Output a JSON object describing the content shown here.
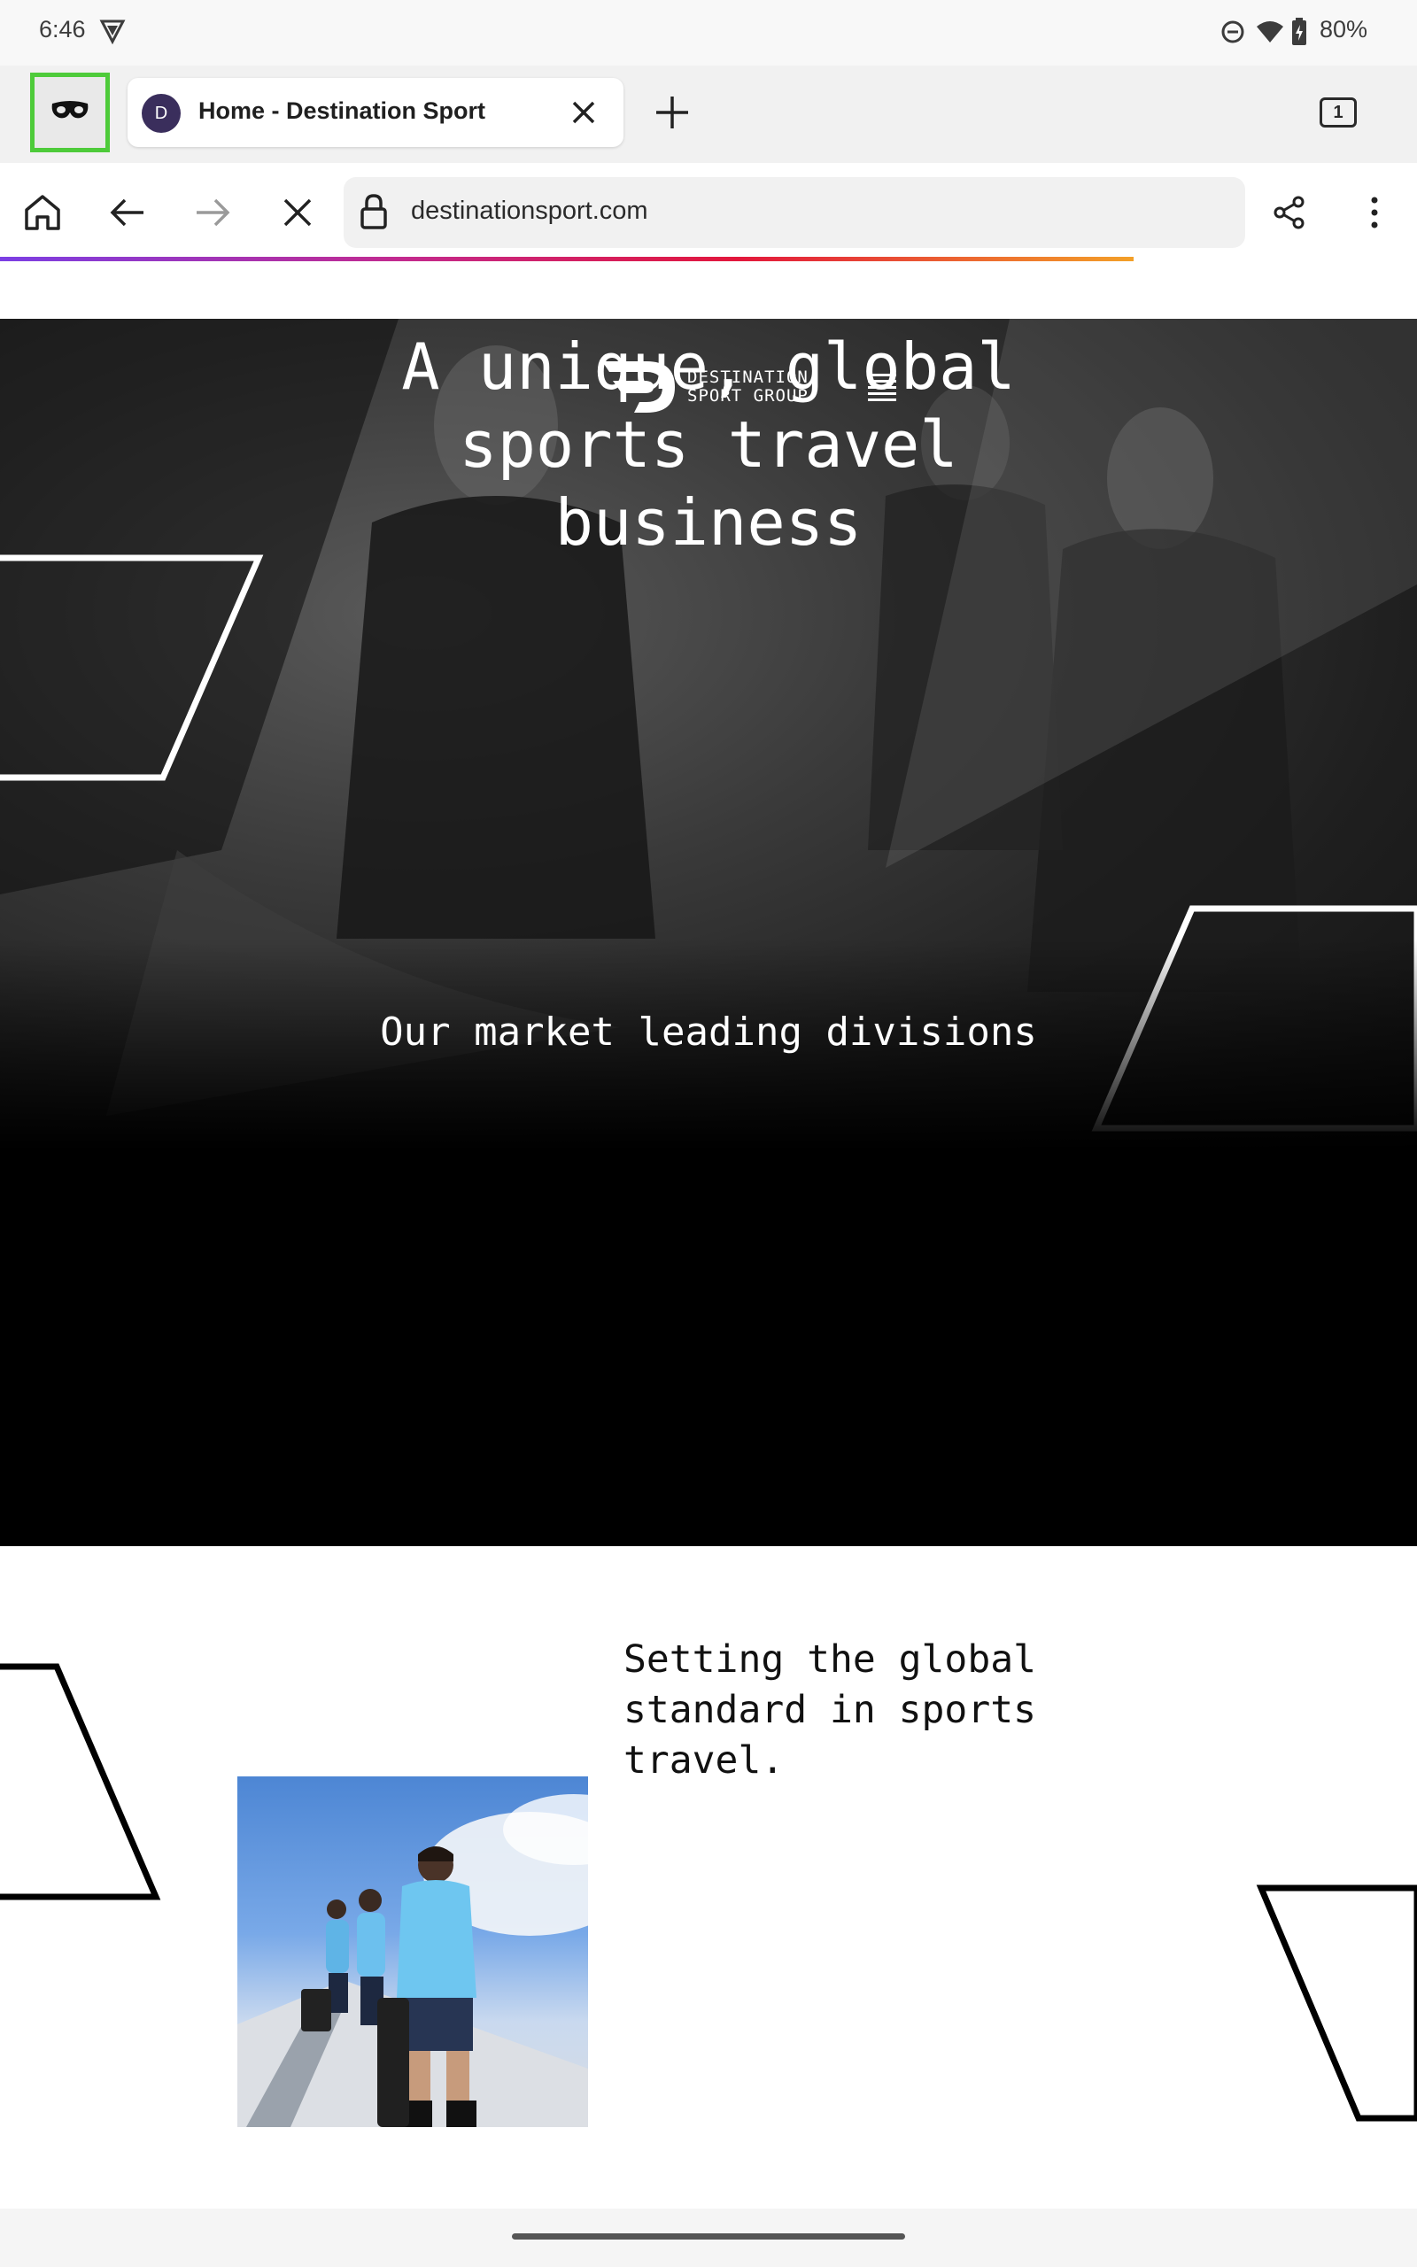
{
  "status_bar": {
    "time": "6:46",
    "battery": "80%"
  },
  "tabs": [
    {
      "avatar_letter": "D",
      "title": "Home - Destination Sport"
    }
  ],
  "tab_count": "1",
  "toolbar": {
    "url": "destinationsport.com"
  },
  "page": {
    "logo_line1": "DESTINATION",
    "logo_line2": "SPORT GROUP",
    "hero_line1": "A unique, global",
    "hero_line2": "sports travel",
    "hero_line3": "business",
    "divisions_heading": "Our market leading divisions",
    "standard_line1": "Setting the global",
    "standard_line2": "standard in sports",
    "standard_line3": "travel."
  },
  "colors": {
    "private_highlight": "#4ecb3a",
    "hero_bg": "#000000",
    "avatar_bg": "#3a2e5c"
  },
  "icons": [
    "private-mask-icon",
    "close-icon",
    "plus-icon",
    "tabs-counter-icon",
    "home-icon",
    "back-icon",
    "forward-icon",
    "stop-icon",
    "lock-icon",
    "share-icon",
    "overflow-menu-icon",
    "hamburger-menu-icon",
    "dnd-icon",
    "wifi-icon",
    "battery-icon",
    "vpn-icon"
  ]
}
